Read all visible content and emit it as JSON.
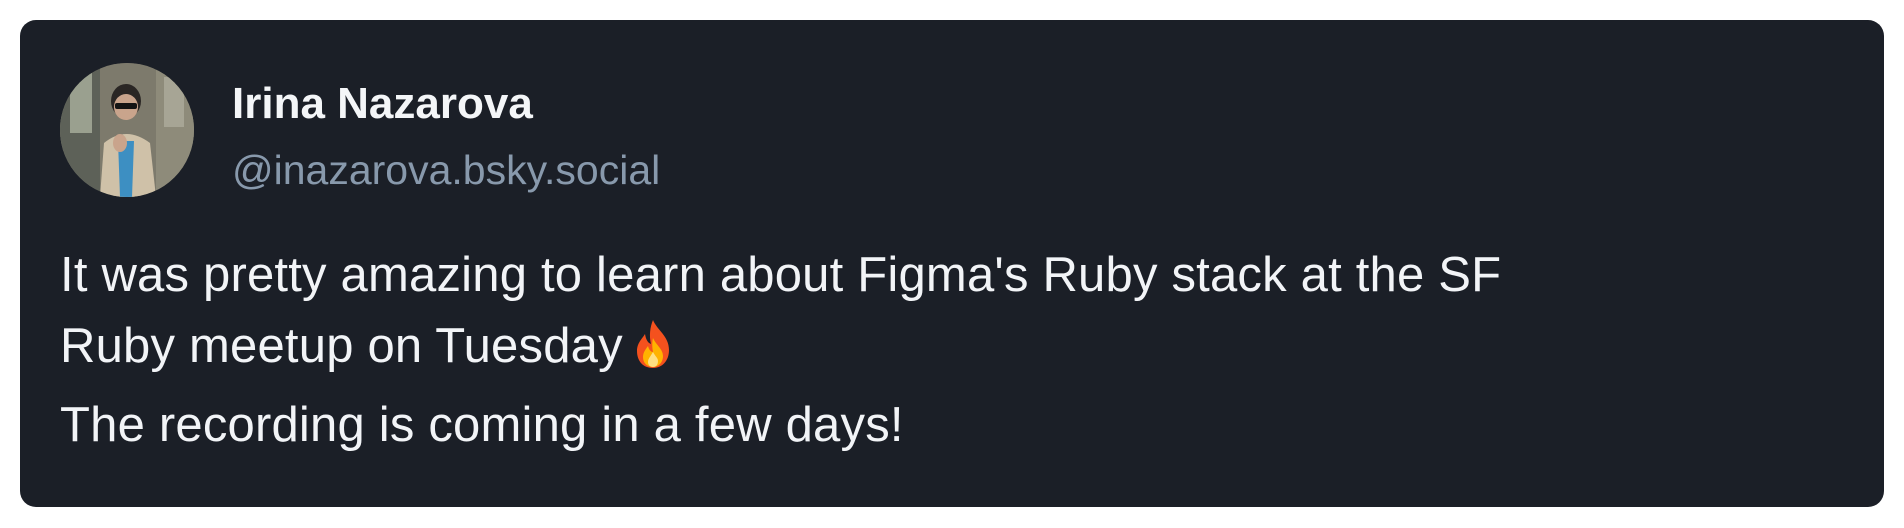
{
  "post": {
    "author": {
      "display_name": "Irina Nazarova",
      "handle": "@inazarova.bsky.social",
      "avatar_icon": "avatar-photo"
    },
    "text_lines": [
      "It was pretty amazing to learn about Figma's Ruby stack at the SF",
      "Ruby meetup on Tuesday",
      "The recording is coming in a few days!"
    ],
    "emoji": "fire-icon"
  },
  "colors": {
    "card_background": "#1b1f27",
    "display_name": "#f4f6f8",
    "handle": "#8899ac",
    "body_text": "#f2f4f7"
  }
}
